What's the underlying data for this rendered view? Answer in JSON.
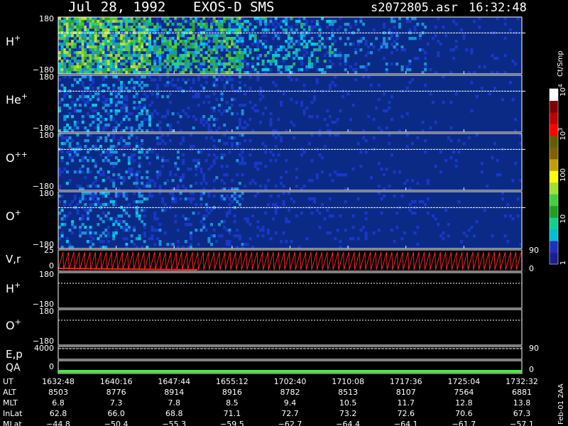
{
  "header": {
    "date": "Jul 28, 1992",
    "instrument": "EXOS-D SMS",
    "file": "s2072805.asr",
    "time": "16:32:48"
  },
  "colors": {
    "background": "#000000",
    "spectrogram_background": "#0a2a86",
    "foreground": "#ffffff",
    "trace_red": "#ff2020",
    "qa_green": "#44ee44"
  },
  "chart_data": [
    {
      "type": "heatmap",
      "panel": "H+",
      "label": "H",
      "label_sup": "+",
      "y_ticks": [
        "180",
        "−180"
      ],
      "intensity_profile": [
        0.9,
        0.7,
        0.4,
        0.2,
        0.08
      ],
      "note_x_range": [
        "1632:48",
        "1732:32"
      ]
    },
    {
      "type": "heatmap",
      "panel": "He+",
      "label": "He",
      "label_sup": "+",
      "y_ticks": [
        "180",
        "−180"
      ],
      "intensity_profile": [
        0.35,
        0.2,
        0.1,
        0.05,
        0.03
      ]
    },
    {
      "type": "heatmap",
      "panel": "O++",
      "label": "O",
      "label_sup": "++",
      "y_ticks": [
        "180",
        "−180"
      ],
      "intensity_profile": [
        0.3,
        0.18,
        0.09,
        0.05,
        0.04
      ]
    },
    {
      "type": "heatmap",
      "panel": "O+",
      "label": "O",
      "label_sup": "+",
      "y_ticks": [
        "180",
        "−180"
      ],
      "intensity_profile": [
        0.32,
        0.2,
        0.1,
        0.06,
        0.04
      ]
    },
    {
      "type": "line",
      "panel": "V,r",
      "label": "V,r",
      "y_ticks_left": [
        "25",
        "0"
      ],
      "y_ticks_right": [
        "90",
        "0"
      ]
    },
    {
      "type": "line",
      "panel": "H+ pitch",
      "label": "H",
      "label_sup": "+",
      "y_ticks": [
        "180",
        "−180"
      ]
    },
    {
      "type": "line",
      "panel": "O+ pitch",
      "label": "O",
      "label_sup": "+",
      "y_ticks": [
        "180",
        "−180"
      ]
    },
    {
      "type": "line",
      "panel": "E,p",
      "label": "E,p",
      "y_ticks_left": [
        "4000"
      ],
      "y_ticks_right": [
        "90"
      ]
    },
    {
      "type": "bar",
      "panel": "QA",
      "label": "QA",
      "y_ticks_left": [
        "0"
      ],
      "y_ticks_right": [
        "0"
      ]
    },
    {
      "type": "table",
      "rows": [
        {
          "label": "UT",
          "values": [
            "1632:48",
            "1640:16",
            "1647:44",
            "1655:12",
            "1702:40",
            "1710:08",
            "1717:36",
            "1725:04",
            "1732:32"
          ]
        },
        {
          "label": "ALT",
          "values": [
            "8503",
            "8776",
            "8914",
            "8916",
            "8782",
            "8513",
            "8107",
            "7564",
            "6881"
          ]
        },
        {
          "label": "MLT",
          "values": [
            "6.8",
            "7.3",
            "7.8",
            "8.5",
            "9.4",
            "10.5",
            "11.7",
            "12.8",
            "13.8"
          ]
        },
        {
          "label": "InLat",
          "values": [
            "62.8",
            "66.0",
            "68.8",
            "71.1",
            "72.7",
            "73.2",
            "72.6",
            "70.6",
            "67.3"
          ]
        },
        {
          "label": "MLat",
          "values": [
            "−44.8",
            "−50.4",
            "−55.3",
            "−59.5",
            "−62.7",
            "−64.4",
            "−64.1",
            "−61.7",
            "−57.1"
          ]
        }
      ]
    },
    {
      "type": "heatmap",
      "panel": "colorbar",
      "unit": "Ct/Smp",
      "tick_labels": [
        "1",
        "10",
        "100"
      ],
      "tick_powers": [
        {
          "base": "10",
          "exp": "3"
        },
        {
          "base": "10",
          "exp": "4"
        }
      ],
      "colors": [
        "#1a2090",
        "#2030c0",
        "#00bcd4",
        "#10d090",
        "#20a020",
        "#40d040",
        "#a0e030",
        "#ffff00",
        "#c0a000",
        "#806000",
        "#606000",
        "#ff0000",
        "#c00000",
        "#800000",
        "#ffffff"
      ]
    }
  ],
  "footer": {
    "stamp": "Feb-01 2AA"
  }
}
